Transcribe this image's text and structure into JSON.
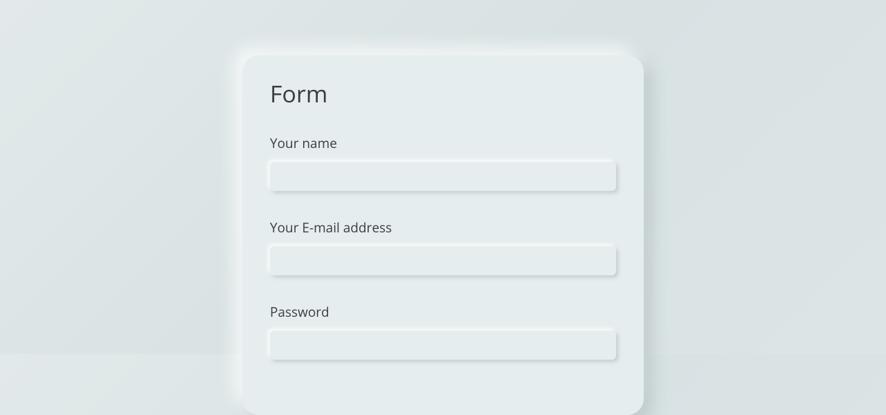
{
  "form": {
    "title": "Form",
    "fields": {
      "name": {
        "label": "Your name",
        "value": ""
      },
      "email": {
        "label": "Your E-mail address",
        "value": ""
      },
      "password": {
        "label": "Password",
        "value": ""
      }
    }
  }
}
